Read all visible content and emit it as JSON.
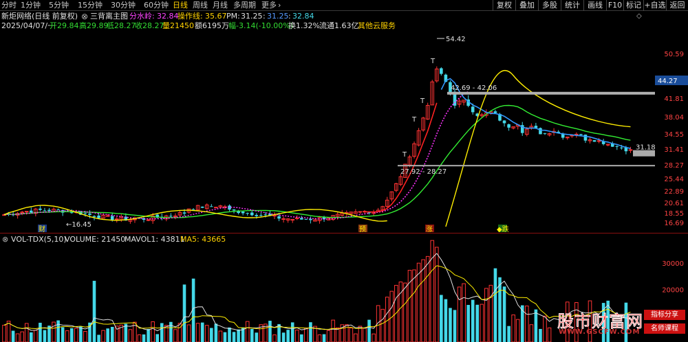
{
  "toolbar": {
    "periods": [
      "分时",
      "1分钟",
      "5分钟",
      "15分钟",
      "30分钟",
      "60分钟",
      "日线",
      "周线",
      "月线",
      "多周期",
      "更多"
    ],
    "active_period": "日线",
    "more_icon": "chevron-right-icon",
    "right_buttons": [
      "复权",
      "叠加",
      "多股",
      "统计",
      "画线",
      "F10",
      "标记",
      "+自选",
      "返回"
    ]
  },
  "info": {
    "stock_title": "新炬网络(日线 前复权)",
    "indicator_name": "三背离主图",
    "fs_label": "分水岭:",
    "fs_value": "32.84",
    "czx_label": "操作线:",
    "czx_value": "35.67",
    "pm_label": "PM:",
    "pm_value": "31.25",
    "colon1": ":",
    "v1": "31.25",
    "colon2": ":",
    "v2": "32.84",
    "date": "2025/04/07/一",
    "open": "开29.84",
    "high": "高29.89",
    "low": "低28.27",
    "close": "收28.27",
    "volume": "量21450",
    "amount": "额6195万",
    "change": "幅-3.14(-10.00%)",
    "turnover": "换1.32%",
    "float": "流通1.63亿",
    "service": "其他云服务",
    "close_icon": "close-icon",
    "diamond_icon": "diamond-icon"
  },
  "axis": {
    "price_ticks": [
      "50.59",
      "44.27",
      "41.81",
      "38.04",
      "34.55",
      "31.41",
      "28.27",
      "25.44",
      "22.89",
      "20.61",
      "18.55",
      "16.69"
    ],
    "current_price": "44.27",
    "vol_ticks": [
      "30000",
      "20000"
    ]
  },
  "annotations": {
    "high_label": "54.42",
    "low_label": "16.45",
    "range1": "42.69 - 42.06",
    "range2": "27.92 - 28.27",
    "level_right": "31.18",
    "marker_cai": "财",
    "marker_yu": "预",
    "marker_zhang": "涨",
    "marker_die": "跌"
  },
  "volume_header": {
    "name": "VOL-TDX(5,10)",
    "vol": "VOLUME: 21450",
    "mavol1": "MAVOL1: 43811",
    "ma5": "MA5: 43665",
    "close_icon": "close-icon"
  },
  "watermark": {
    "title": "股市财富网",
    "url": "WWW.GSCFW.COM",
    "tag1": "指标分享",
    "tag2": "名师课程"
  },
  "colors": {
    "up": "#ff3333",
    "down": "#44d8e8",
    "line_white": "#e0e0e0",
    "line_yellow": "#ffee00",
    "line_green": "#33ee33",
    "line_magenta": "#ff33ff",
    "line_red": "#ff2222",
    "line_blue": "#3399ff",
    "level_band": "#b0b0b0"
  }
}
